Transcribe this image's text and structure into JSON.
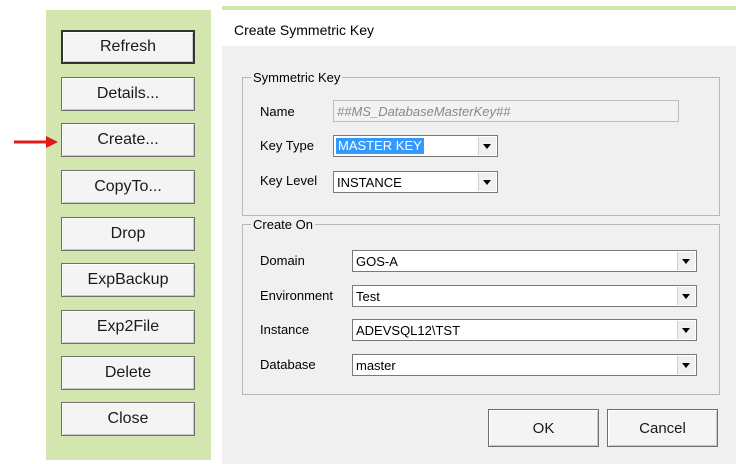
{
  "left_buttons": [
    {
      "label": "Refresh"
    },
    {
      "label": "Details..."
    },
    {
      "label": "Create..."
    },
    {
      "label": "CopyTo..."
    },
    {
      "label": "Drop"
    },
    {
      "label": "ExpBackup"
    },
    {
      "label": "Exp2File"
    },
    {
      "label": "Delete"
    },
    {
      "label": "Close"
    }
  ],
  "dialog": {
    "title": "Create Symmetric Key",
    "symmetric_key": {
      "legend": "Symmetric Key",
      "name_label": "Name",
      "name_value": "##MS_DatabaseMasterKey##",
      "key_type_label": "Key Type",
      "key_type_value": "MASTER KEY",
      "key_level_label": "Key Level",
      "key_level_value": "INSTANCE"
    },
    "create_on": {
      "legend": "Create On",
      "domain_label": "Domain",
      "domain_value": "GOS-A",
      "environment_label": "Environment",
      "environment_value": "Test",
      "instance_label": "Instance",
      "instance_value": "ADEVSQL12\\TST",
      "database_label": "Database",
      "database_value": "master"
    },
    "ok_label": "OK",
    "cancel_label": "Cancel"
  },
  "colors": {
    "panel_green": "#d4e6b0",
    "arrow_red": "#e01b1b",
    "selection_blue": "#3399ff"
  }
}
